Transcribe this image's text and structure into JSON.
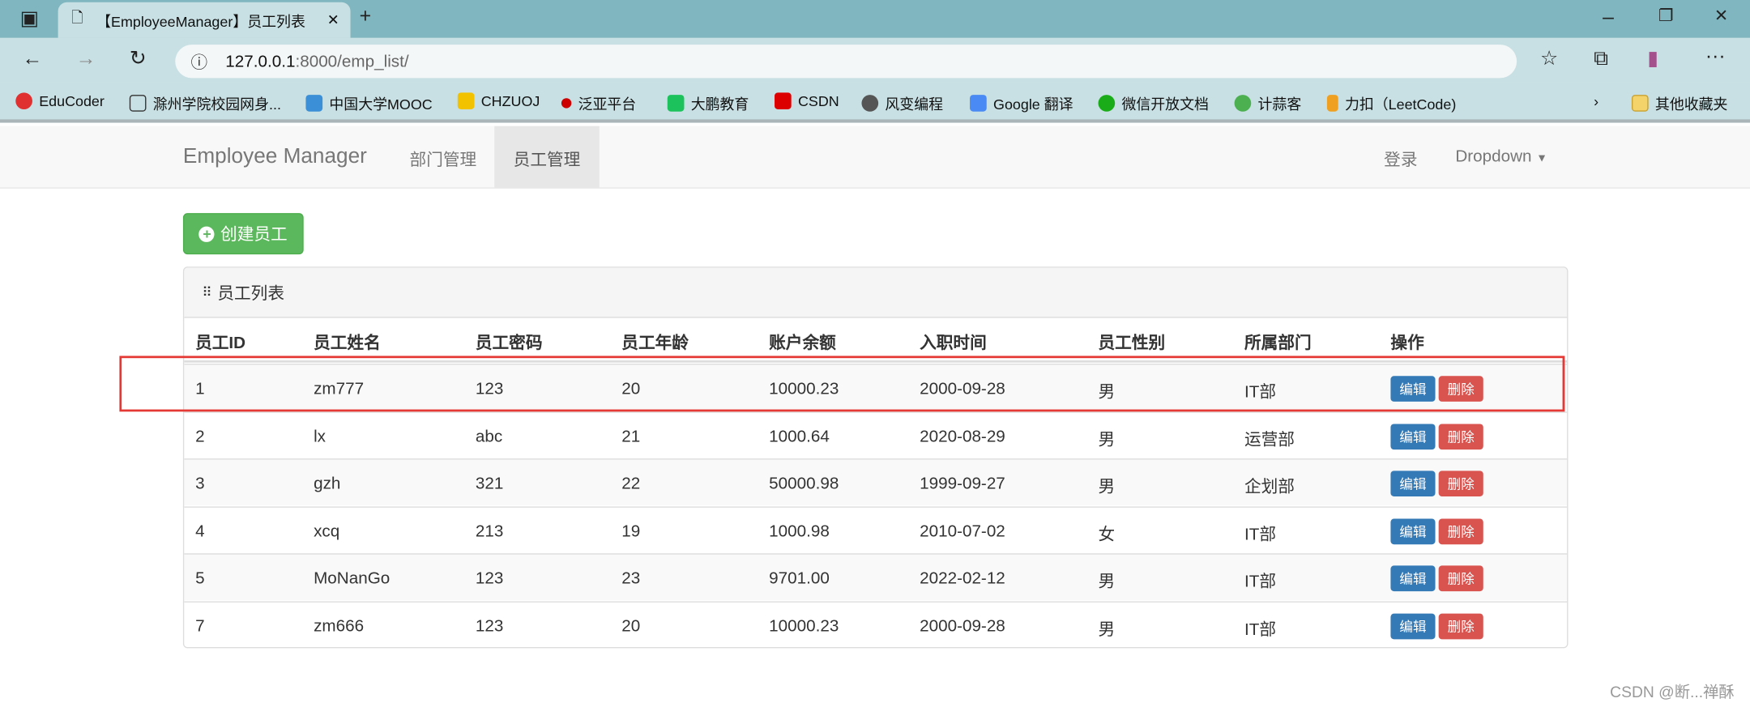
{
  "browser": {
    "tab_title": "【EmployeeManager】员工列表",
    "url_host": "127.0.0.1",
    "url_rest": ":8000/emp_list/",
    "bookmarks": [
      "EduCoder",
      "滁州学院校园网身...",
      "中国大学MOOC",
      "CHZUOJ",
      "泛亚平台",
      "大鹏教育",
      "CSDN",
      "风变编程",
      "Google 翻译",
      "微信开放文档",
      "计蒜客",
      "力扣（LeetCode)"
    ],
    "other_bookmarks": "其他收藏夹"
  },
  "navbar": {
    "brand": "Employee Manager",
    "items": [
      "部门管理",
      "员工管理"
    ],
    "active": "员工管理",
    "login": "登录",
    "dropdown": "Dropdown"
  },
  "create_button": "创建员工",
  "panel": {
    "title": "员工列表"
  },
  "table": {
    "headers": [
      "员工ID",
      "员工姓名",
      "员工密码",
      "员工年龄",
      "账户余额",
      "入职时间",
      "员工性别",
      "所属部门",
      "操作"
    ],
    "rows": [
      [
        "1",
        "zm777",
        "123",
        "20",
        "10000.23",
        "2000-09-28",
        "男",
        "IT部"
      ],
      [
        "2",
        "lx",
        "abc",
        "21",
        "1000.64",
        "2020-08-29",
        "男",
        "运营部"
      ],
      [
        "3",
        "gzh",
        "321",
        "22",
        "50000.98",
        "1999-09-27",
        "男",
        "企划部"
      ],
      [
        "4",
        "xcq",
        "213",
        "19",
        "1000.98",
        "2010-07-02",
        "女",
        "IT部"
      ],
      [
        "5",
        "MoNanGo",
        "123",
        "23",
        "9701.00",
        "2022-02-12",
        "男",
        "IT部"
      ],
      [
        "7",
        "zm666",
        "123",
        "20",
        "10000.23",
        "2000-09-28",
        "男",
        "IT部"
      ]
    ],
    "edit_label": "编辑",
    "delete_label": "删除",
    "highlighted_row": 1
  },
  "colors": {
    "success": "#5cb85c",
    "primary": "#337ab7",
    "danger": "#d9534f",
    "highlight": "#e53935"
  },
  "watermark": "CSDN @断...禅酥"
}
